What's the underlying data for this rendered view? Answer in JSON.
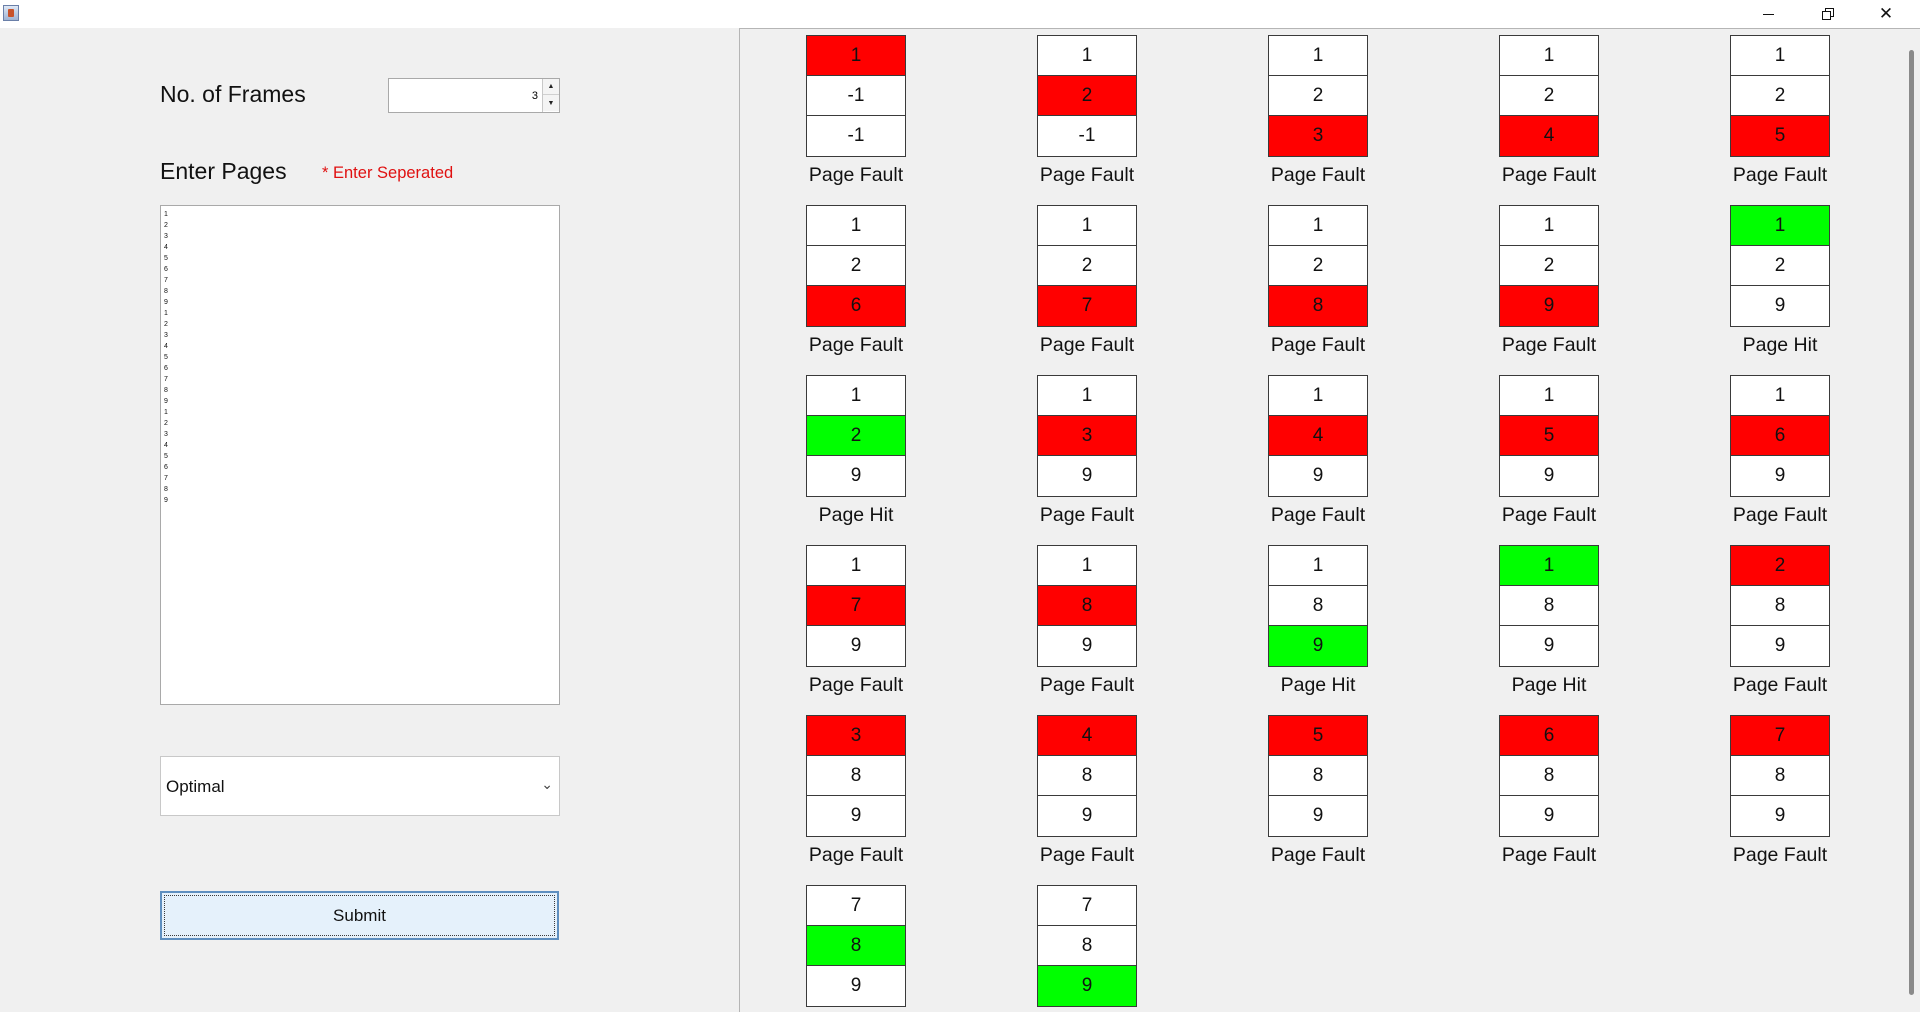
{
  "window": {
    "controls": {
      "minimize": "minimize-icon",
      "restore": "restore-icon",
      "close": "close-icon"
    }
  },
  "form": {
    "frames_label": "No. of Frames",
    "frames_value": "3",
    "pages_label": "Enter Pages",
    "pages_hint": "* Enter Seperated",
    "pages_lines": [
      "1",
      "2",
      "3",
      "4",
      "5",
      "6",
      "7",
      "8",
      "9",
      "1",
      "2",
      "3",
      "4",
      "5",
      "6",
      "7",
      "8",
      "9",
      "1",
      "2",
      "3",
      "4",
      "5",
      "6",
      "7",
      "8",
      "9"
    ],
    "algorithm": "Optimal",
    "submit_label": "Submit"
  },
  "colors": {
    "fault": "#ff0000",
    "hit": "#00ff00",
    "normal": "#ffffff"
  },
  "steps": [
    {
      "frames": [
        "1",
        "-1",
        "-1"
      ],
      "mark": 0,
      "result": "Page Fault"
    },
    {
      "frames": [
        "1",
        "2",
        "-1"
      ],
      "mark": 1,
      "result": "Page Fault"
    },
    {
      "frames": [
        "1",
        "2",
        "3"
      ],
      "mark": 2,
      "result": "Page Fault"
    },
    {
      "frames": [
        "1",
        "2",
        "4"
      ],
      "mark": 2,
      "result": "Page Fault"
    },
    {
      "frames": [
        "1",
        "2",
        "5"
      ],
      "mark": 2,
      "result": "Page Fault"
    },
    {
      "frames": [
        "1",
        "2",
        "6"
      ],
      "mark": 2,
      "result": "Page Fault"
    },
    {
      "frames": [
        "1",
        "2",
        "7"
      ],
      "mark": 2,
      "result": "Page Fault"
    },
    {
      "frames": [
        "1",
        "2",
        "8"
      ],
      "mark": 2,
      "result": "Page Fault"
    },
    {
      "frames": [
        "1",
        "2",
        "9"
      ],
      "mark": 2,
      "result": "Page Fault"
    },
    {
      "frames": [
        "1",
        "2",
        "9"
      ],
      "mark": 0,
      "result": "Page Hit"
    },
    {
      "frames": [
        "1",
        "2",
        "9"
      ],
      "mark": 1,
      "result": "Page Hit"
    },
    {
      "frames": [
        "1",
        "3",
        "9"
      ],
      "mark": 1,
      "result": "Page Fault"
    },
    {
      "frames": [
        "1",
        "4",
        "9"
      ],
      "mark": 1,
      "result": "Page Fault"
    },
    {
      "frames": [
        "1",
        "5",
        "9"
      ],
      "mark": 1,
      "result": "Page Fault"
    },
    {
      "frames": [
        "1",
        "6",
        "9"
      ],
      "mark": 1,
      "result": "Page Fault"
    },
    {
      "frames": [
        "1",
        "7",
        "9"
      ],
      "mark": 1,
      "result": "Page Fault"
    },
    {
      "frames": [
        "1",
        "8",
        "9"
      ],
      "mark": 1,
      "result": "Page Fault"
    },
    {
      "frames": [
        "1",
        "8",
        "9"
      ],
      "mark": 2,
      "result": "Page Hit"
    },
    {
      "frames": [
        "1",
        "8",
        "9"
      ],
      "mark": 0,
      "result": "Page Hit"
    },
    {
      "frames": [
        "2",
        "8",
        "9"
      ],
      "mark": 0,
      "result": "Page Fault"
    },
    {
      "frames": [
        "3",
        "8",
        "9"
      ],
      "mark": 0,
      "result": "Page Fault"
    },
    {
      "frames": [
        "4",
        "8",
        "9"
      ],
      "mark": 0,
      "result": "Page Fault"
    },
    {
      "frames": [
        "5",
        "8",
        "9"
      ],
      "mark": 0,
      "result": "Page Fault"
    },
    {
      "frames": [
        "6",
        "8",
        "9"
      ],
      "mark": 0,
      "result": "Page Fault"
    },
    {
      "frames": [
        "7",
        "8",
        "9"
      ],
      "mark": 0,
      "result": "Page Fault"
    },
    {
      "frames": [
        "7",
        "8",
        "9"
      ],
      "mark": 1,
      "result": "Page Hit"
    },
    {
      "frames": [
        "7",
        "8",
        "9"
      ],
      "mark": 2,
      "result": "Page Hit"
    }
  ]
}
